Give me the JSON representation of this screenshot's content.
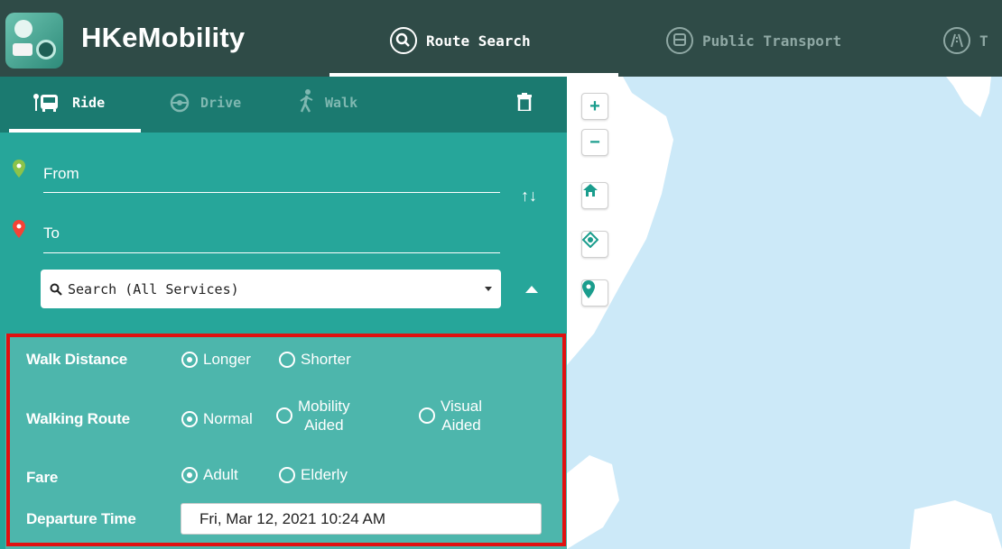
{
  "header": {
    "app_name": "HKeMobility",
    "nav": [
      {
        "label": "Route Search",
        "active": true
      },
      {
        "label": "Public Transport",
        "active": false
      },
      {
        "label": "T",
        "active": false
      }
    ]
  },
  "mode_tabs": [
    {
      "label": "Ride",
      "active": true,
      "icon": "bus-stop-icon"
    },
    {
      "label": "Drive",
      "active": false,
      "icon": "steering-wheel-icon"
    },
    {
      "label": "Walk",
      "active": false,
      "icon": "walking-person-icon"
    }
  ],
  "locations": {
    "from_label": "From",
    "to_label": "To",
    "from_pin_color": "#8bc34a",
    "to_pin_color": "#f44336"
  },
  "search": {
    "selected": "Search (All Services)"
  },
  "options": {
    "walk_distance": {
      "label": "Walk Distance",
      "choices": [
        "Longer",
        "Shorter"
      ],
      "selected": "Longer"
    },
    "walking_route": {
      "label": "Walking Route",
      "choices": [
        "Normal",
        "Mobility Aided",
        "Visual Aided"
      ],
      "choice_lines": [
        [
          "Normal"
        ],
        [
          "Mobility",
          "Aided"
        ],
        [
          "Visual",
          "Aided"
        ]
      ],
      "selected": "Normal"
    },
    "fare": {
      "label": "Fare",
      "choices": [
        "Adult",
        "Elderly"
      ],
      "selected": "Adult"
    },
    "departure_time": {
      "label": "Departure Time",
      "value": "Fri, Mar 12, 2021 10:24 AM"
    }
  },
  "map": {
    "zoom_in": "+",
    "zoom_out": "−",
    "water_color": "#cce9f8",
    "land_color": "#ffffff"
  },
  "colors": {
    "header": "#2f4b47",
    "tab_bar": "#1b7a70",
    "sidebar": "#26a69a",
    "options_panel": "#4db6ac",
    "highlight_frame": "#e01010"
  }
}
